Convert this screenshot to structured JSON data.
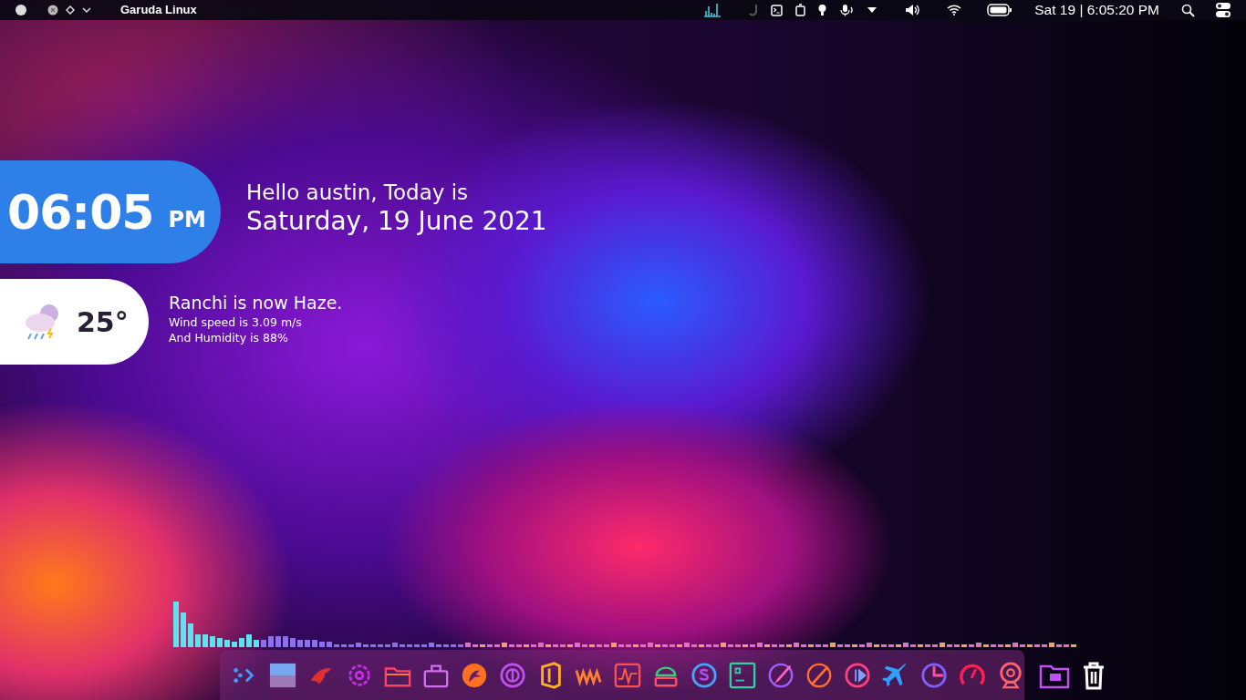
{
  "top_bar": {
    "title": "Garuda Linux",
    "clock": "Sat 19 | 6:05:20 PM"
  },
  "clock_widget": {
    "time": "06:05",
    "meridiem": "PM",
    "greeting": "Hello austin, Today is",
    "date": "Saturday, 19 June 2021"
  },
  "weather_widget": {
    "temperature": "25°",
    "headline": "Ranchi is now Haze.",
    "wind": "Wind speed is 3.09 m/s",
    "humidity": "And Humidity is 88%"
  }
}
